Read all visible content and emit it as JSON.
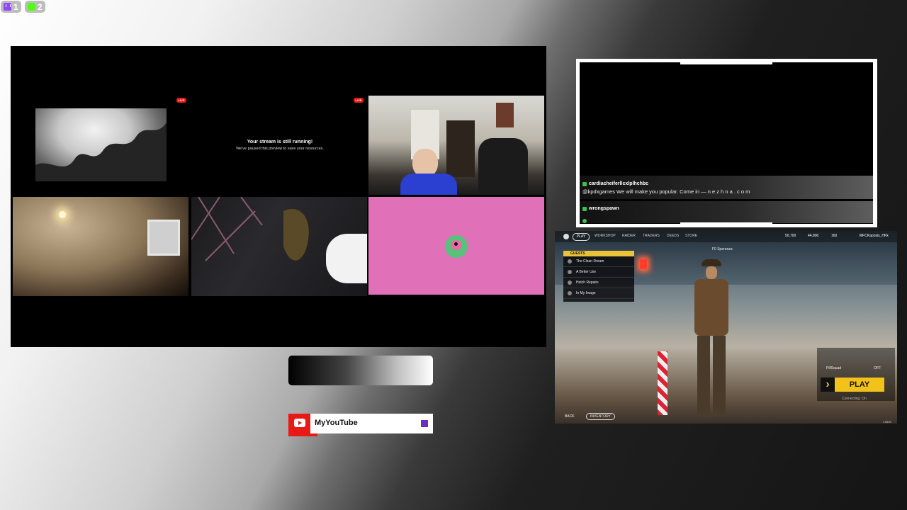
{
  "counters": [
    {
      "icon": "twitch-icon",
      "count": "1"
    },
    {
      "icon": "kick-icon",
      "count": "2"
    }
  ],
  "stage": {
    "live_label": "LIVE",
    "paused_title": "Your stream is still running!",
    "paused_subtitle": "We've paused this preview to save your resources."
  },
  "chat": {
    "messages": [
      {
        "user": "cardiacheiferllcxlplhchbc",
        "text": "@kpdxgames We will make you popular. Come in — n e z h n a . c o m"
      },
      {
        "user": "wrongspawn",
        "text": ""
      }
    ]
  },
  "game": {
    "tabs": [
      "PLAY",
      "WORKSHOP",
      "RAIDER",
      "TRADERS",
      "DEEDS",
      "STORE"
    ],
    "resources": [
      "50,700",
      "44,800",
      "160",
      "MFCKaposis_HKk"
    ],
    "guests_title": "GUESTS",
    "guests": [
      "The Clean Dream",
      "A Better Use",
      "Hatch Repairs",
      "In My Image"
    ],
    "player_name": "F0 Speranza",
    "mode_label": "PillSquad",
    "mode_state": "OFF",
    "play_label": "PLAY",
    "bottom_left": [
      "BACK",
      "INVENTORY"
    ],
    "server_text": "Connecting: On",
    "build": "v.5505"
  },
  "youtube": {
    "label": "MyYouTube"
  },
  "colors": {
    "live_red": "#e91916",
    "twitch_purple": "#9146ff",
    "kick_green": "#53fc18",
    "overlay_pink": "#e070b8",
    "game_yellow": "#f2c21a"
  }
}
